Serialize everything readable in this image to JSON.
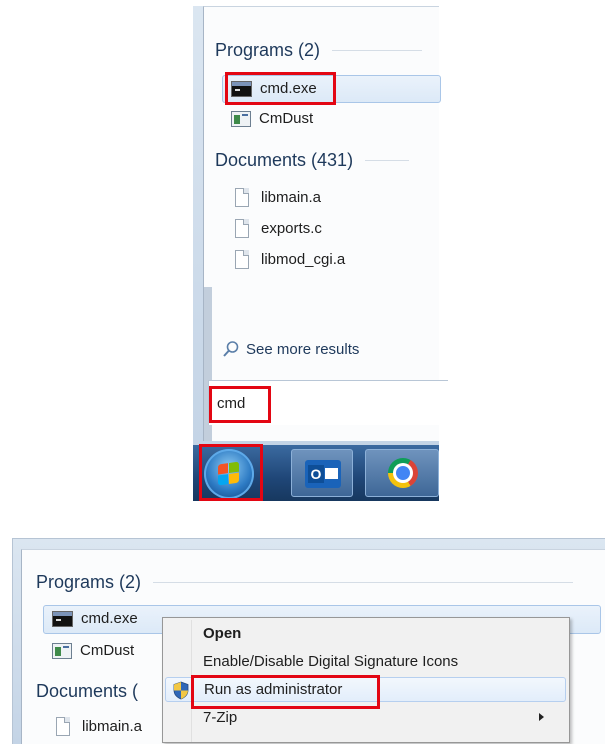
{
  "top_panel": {
    "programs_heading": "Programs (2)",
    "programs": [
      {
        "label": "cmd.exe",
        "icon": "cmd-icon"
      },
      {
        "label": "CmDust",
        "icon": "cmdust-icon"
      }
    ],
    "documents_heading": "Documents (431)",
    "documents": [
      {
        "label": "libmain.a",
        "icon": "document-icon"
      },
      {
        "label": "exports.c",
        "icon": "document-icon"
      },
      {
        "label": "libmod_cgi.a",
        "icon": "document-icon"
      }
    ],
    "see_more": "See more results",
    "search_value": "cmd",
    "taskbar": [
      "start-orb-icon",
      "outlook-icon",
      "chrome-icon"
    ]
  },
  "bottom_panel": {
    "programs_heading": "Programs (2)",
    "programs": [
      {
        "label": "cmd.exe"
      },
      {
        "label": "CmDust"
      }
    ],
    "documents_heading_partial": "Documents (",
    "documents": [
      {
        "label": "libmain.a"
      }
    ],
    "context_menu": [
      {
        "label": "Open",
        "bold": true
      },
      {
        "label": "Enable/Disable Digital Signature Icons"
      },
      {
        "label": "Run as administrator",
        "icon": "uac-shield-icon"
      },
      {
        "label": "7-Zip",
        "submenu": true
      }
    ]
  },
  "colors": {
    "highlight_box": "#e30613",
    "heading_text": "#1e395b",
    "taskbar": "#1f4677"
  }
}
